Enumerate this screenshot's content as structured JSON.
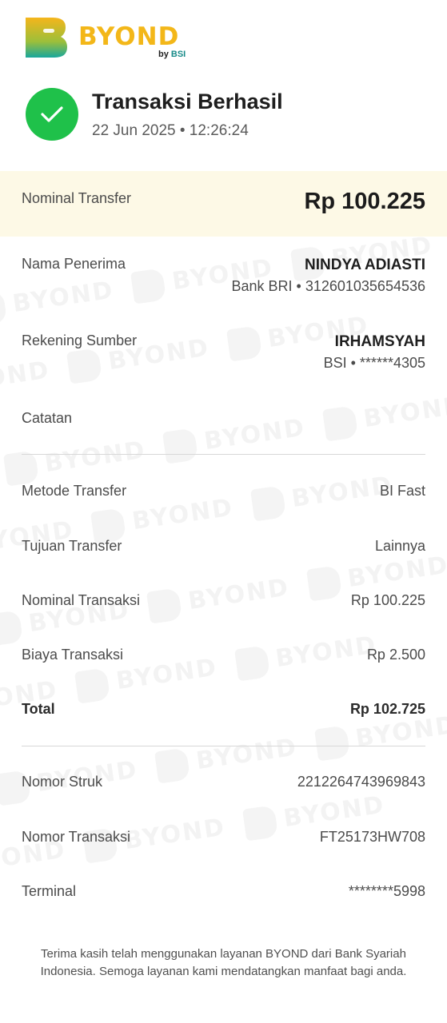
{
  "brand": {
    "name": "BYOND",
    "by_prefix": "by",
    "by_brand": "BSI"
  },
  "status": {
    "title": "Transaksi Berhasil",
    "datetime": "22 Jun 2025 • 12:26:24"
  },
  "nominal": {
    "label": "Nominal Transfer",
    "value": "Rp 100.225"
  },
  "recipient": {
    "label": "Nama Penerima",
    "name": "NINDYA ADIASTI",
    "account": "Bank BRI • 312601035654536"
  },
  "source": {
    "label": "Rekening Sumber",
    "name": "IRHAMSYAH",
    "account": "BSI • ******4305"
  },
  "note": {
    "label": "Catatan",
    "value": ""
  },
  "details": [
    {
      "label": "Metode Transfer",
      "value": "BI Fast"
    },
    {
      "label": "Tujuan Transfer",
      "value": "Lainnya"
    },
    {
      "label": "Nominal Transaksi",
      "value": "Rp 100.225"
    },
    {
      "label": "Biaya Transaksi",
      "value": "Rp 2.500"
    }
  ],
  "total": {
    "label": "Total",
    "value": "Rp 102.725"
  },
  "references": [
    {
      "label": "Nomor Struk",
      "value": "2212264743969843"
    },
    {
      "label": "Nomor Transaksi",
      "value": "FT25173HW708"
    },
    {
      "label": "Terminal",
      "value": "********5998"
    }
  ],
  "footer": "Terima kasih telah menggunakan layanan BYOND dari Bank Syariah Indonesia. Semoga layanan kami mendatangkan manfaat bagi anda.",
  "colors": {
    "success": "#1fc14a",
    "brand_yellow": "#f3b719",
    "brand_teal": "#178a88",
    "highlight_band": "#fdf9e6"
  }
}
